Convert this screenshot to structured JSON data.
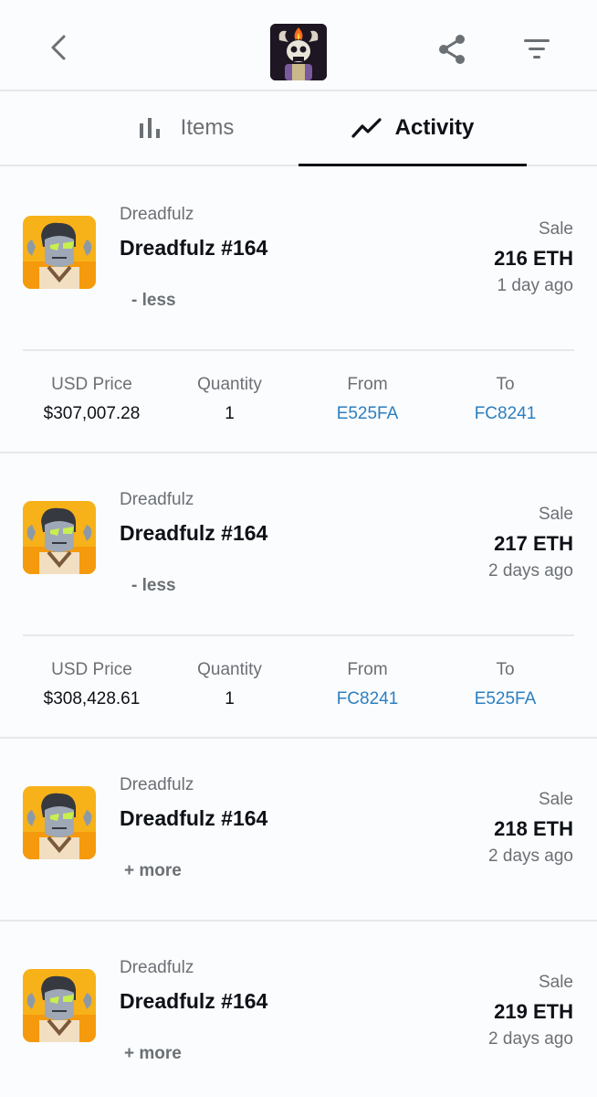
{
  "header": {
    "back_icon": "chevron-left-icon",
    "logo_icon": "collection-avatar-icon",
    "share_icon": "share-icon",
    "filter_icon": "filter-icon"
  },
  "tabs": [
    {
      "label": "Items",
      "icon": "bar-chart-icon",
      "active": false
    },
    {
      "label": "Activity",
      "icon": "trend-line-icon",
      "active": true
    }
  ],
  "detail_labels": {
    "usd_price": "USD Price",
    "quantity": "Quantity",
    "from": "From",
    "to": "To"
  },
  "activity": [
    {
      "collection": "Dreadfulz",
      "name": "Dreadfulz #164",
      "toggle": "- less",
      "event": "Sale",
      "price": "216 ETH",
      "time": "1 day ago",
      "usd_price": "$307,007.28",
      "quantity": "1",
      "from": "E525FA",
      "to": "FC8241"
    },
    {
      "collection": "Dreadfulz",
      "name": "Dreadfulz #164",
      "toggle": "- less",
      "event": "Sale",
      "price": "217 ETH",
      "time": "2 days ago",
      "usd_price": "$308,428.61",
      "quantity": "1",
      "from": "FC8241",
      "to": "E525FA"
    },
    {
      "collection": "Dreadfulz",
      "name": "Dreadfulz #164",
      "toggle": "+ more",
      "event": "Sale",
      "price": "218 ETH",
      "time": "2 days ago"
    },
    {
      "collection": "Dreadfulz",
      "name": "Dreadfulz #164",
      "toggle": "+ more",
      "event": "Sale",
      "price": "219 ETH",
      "time": "2 days ago"
    }
  ],
  "colors": {
    "accent": "#0d1117",
    "link": "#2c7fc0",
    "muted": "#6b7075",
    "divider": "#e6e8eb"
  }
}
